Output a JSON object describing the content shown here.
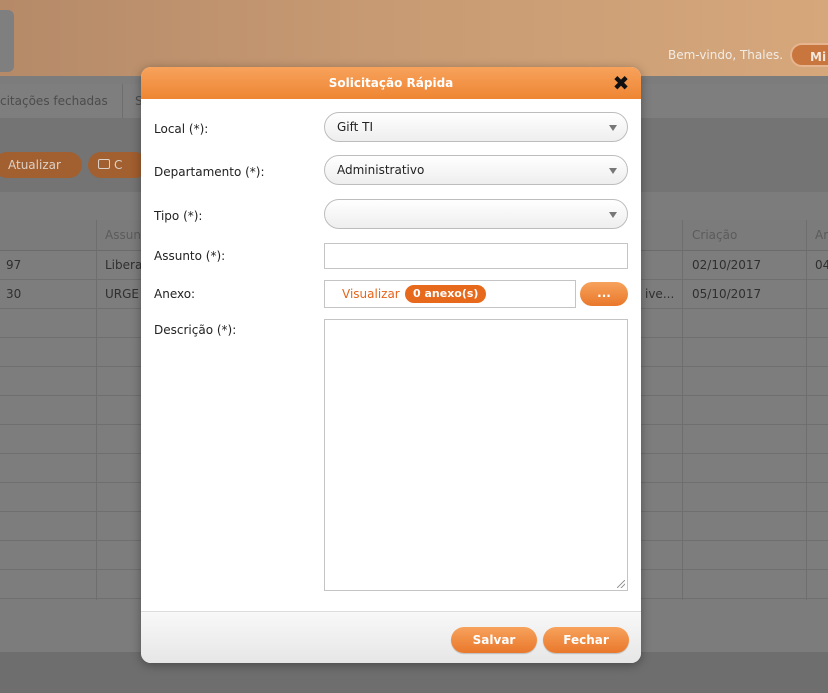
{
  "header": {
    "welcome": "Bem-vindo, Thales.",
    "menu_button": "Mi"
  },
  "tabs": [
    "citações fechadas",
    "S"
  ],
  "toolbar": {
    "refresh": "Atualizar",
    "chat": "C"
  },
  "grid": {
    "columns": [
      "Assun",
      "Criação",
      "Ar"
    ],
    "rows": [
      {
        "id": "97",
        "subject": "Libera",
        "extra": "",
        "created": "02/10/2017",
        "other": "04"
      },
      {
        "id": "30",
        "subject": "URGE",
        "extra": "ive...",
        "created": "05/10/2017",
        "other": ""
      }
    ]
  },
  "modal": {
    "title": "Solicitação Rápida",
    "close": "✖",
    "fields": {
      "local_label": "Local (*):",
      "local_value": "Gift TI",
      "departamento_label": "Departamento (*):",
      "departamento_value": "Administrativo",
      "tipo_label": "Tipo (*):",
      "tipo_value": "",
      "assunto_label": "Assunto (*):",
      "anexo_label": "Anexo:",
      "anexo_link": "Visualizar",
      "anexo_count": "0 anexo(s)",
      "anexo_button": "...",
      "descricao_label": "Descrição (*):"
    },
    "buttons": {
      "save": "Salvar",
      "close": "Fechar"
    }
  },
  "colors": {
    "accent": "#ee8633",
    "link": "#e4651b"
  }
}
